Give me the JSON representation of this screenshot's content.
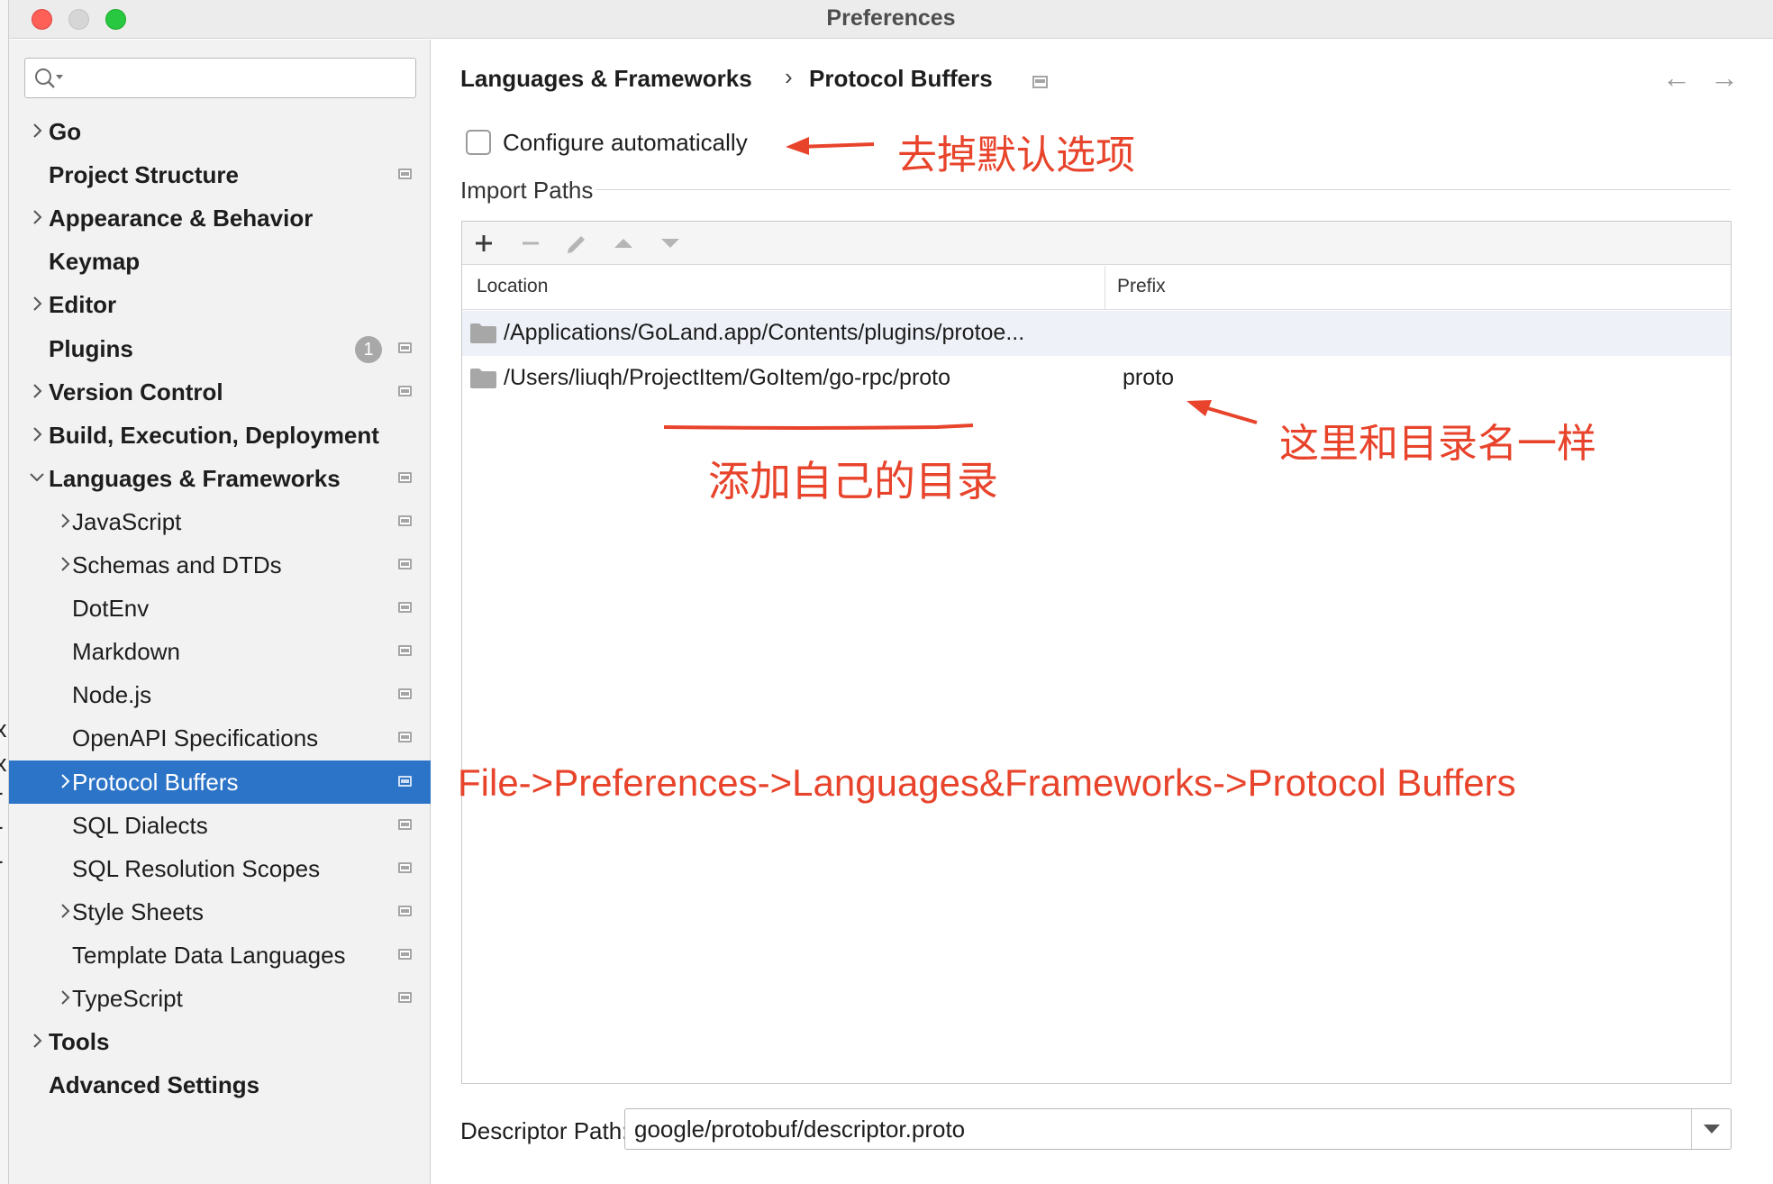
{
  "window": {
    "title": "Preferences"
  },
  "sidebar": {
    "search": {
      "placeholder": "",
      "value": ""
    },
    "items": [
      {
        "label": "Go",
        "bold": true,
        "chevron": "right",
        "indent": 0,
        "icon": false
      },
      {
        "label": "Project Structure",
        "bold": true,
        "chevron": "none",
        "indent": 0,
        "icon": true
      },
      {
        "label": "Appearance & Behavior",
        "bold": true,
        "chevron": "right",
        "indent": 0,
        "icon": false
      },
      {
        "label": "Keymap",
        "bold": true,
        "chevron": "none",
        "indent": 0,
        "icon": false
      },
      {
        "label": "Editor",
        "bold": true,
        "chevron": "right",
        "indent": 0,
        "icon": false
      },
      {
        "label": "Plugins",
        "bold": true,
        "chevron": "none",
        "indent": 0,
        "icon": true,
        "badge": "1"
      },
      {
        "label": "Version Control",
        "bold": true,
        "chevron": "right",
        "indent": 0,
        "icon": true
      },
      {
        "label": "Build, Execution, Deployment",
        "bold": true,
        "chevron": "right",
        "indent": 0,
        "icon": false
      },
      {
        "label": "Languages & Frameworks",
        "bold": true,
        "chevron": "down",
        "indent": 0,
        "icon": true
      },
      {
        "label": "JavaScript",
        "bold": false,
        "chevron": "right",
        "indent": 1,
        "icon": true
      },
      {
        "label": "Schemas and DTDs",
        "bold": false,
        "chevron": "right",
        "indent": 1,
        "icon": true
      },
      {
        "label": "DotEnv",
        "bold": false,
        "chevron": "none",
        "indent": 1,
        "icon": true
      },
      {
        "label": "Markdown",
        "bold": false,
        "chevron": "none",
        "indent": 1,
        "icon": true
      },
      {
        "label": "Node.js",
        "bold": false,
        "chevron": "none",
        "indent": 1,
        "icon": true
      },
      {
        "label": "OpenAPI Specifications",
        "bold": false,
        "chevron": "none",
        "indent": 1,
        "icon": true
      },
      {
        "label": "Protocol Buffers",
        "bold": false,
        "chevron": "right",
        "indent": 1,
        "icon": true,
        "selected": true
      },
      {
        "label": "SQL Dialects",
        "bold": false,
        "chevron": "none",
        "indent": 1,
        "icon": true
      },
      {
        "label": "SQL Resolution Scopes",
        "bold": false,
        "chevron": "none",
        "indent": 1,
        "icon": true
      },
      {
        "label": "Style Sheets",
        "bold": false,
        "chevron": "right",
        "indent": 1,
        "icon": true
      },
      {
        "label": "Template Data Languages",
        "bold": false,
        "chevron": "none",
        "indent": 1,
        "icon": true
      },
      {
        "label": "TypeScript",
        "bold": false,
        "chevron": "right",
        "indent": 1,
        "icon": true
      },
      {
        "label": "Tools",
        "bold": true,
        "chevron": "right",
        "indent": 0,
        "icon": false
      },
      {
        "label": "Advanced Settings",
        "bold": true,
        "chevron": "none",
        "indent": 0,
        "icon": false
      }
    ]
  },
  "breadcrumb": {
    "parent": "Languages & Frameworks",
    "separator": "›",
    "current": "Protocol Buffers"
  },
  "nav": {
    "back": "←",
    "forward": "→"
  },
  "configure": {
    "label": "Configure automatically",
    "checked": false
  },
  "import_paths": {
    "title": "Import Paths",
    "columns": {
      "location": "Location",
      "prefix": "Prefix"
    },
    "rows": [
      {
        "location": "/Applications/GoLand.app/Contents/plugins/protoe...",
        "prefix": ""
      },
      {
        "location": "/Users/liuqh/ProjectItem/GoItem/go-rpc/proto",
        "prefix": "proto"
      }
    ]
  },
  "descriptor": {
    "label": "Descriptor Path:",
    "value": "google/protobuf/descriptor.proto"
  },
  "annotations": {
    "uncheck_default": "去掉默认选项",
    "add_own_dir": "添加自己的目录",
    "same_as_dir": "这里和目录名一样",
    "menu_path": "File->Preferences->Languages&Frameworks->Protocol Buffers"
  },
  "edge_glyphs": [
    "x",
    "x",
    "r",
    "r",
    "r"
  ],
  "colors": {
    "selection": "#2c74c7",
    "annotation": "#e8432b"
  }
}
